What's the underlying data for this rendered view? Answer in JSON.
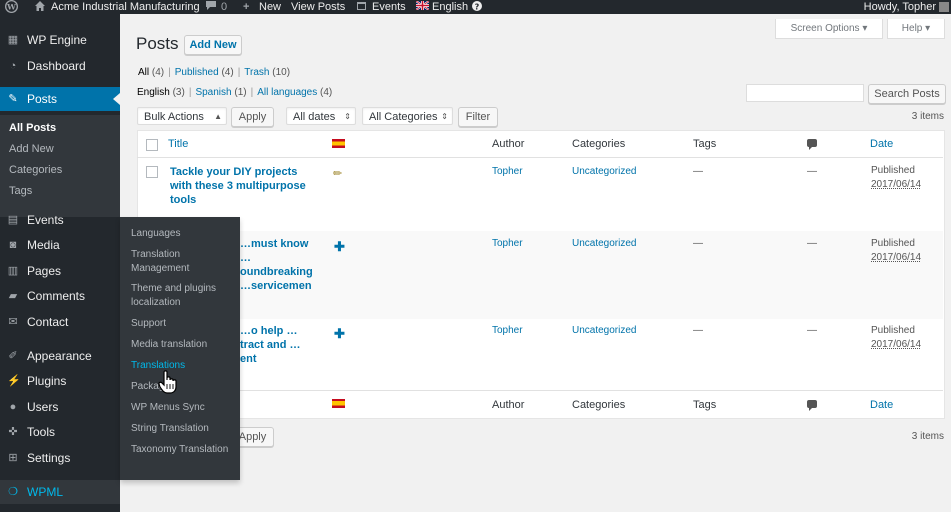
{
  "adminbar": {
    "site_name": "Acme Industrial Manufacturing",
    "comments_count": "0",
    "new_label": "New",
    "view_posts": "View Posts",
    "events": "Events",
    "language": "English",
    "howdy": "Howdy, Topher"
  },
  "sidebar": {
    "wp_engine": "WP Engine",
    "dashboard": "Dashboard",
    "posts": "Posts",
    "posts_submenu": [
      "All Posts",
      "Add New",
      "Categories",
      "Tags"
    ],
    "events": "Events",
    "media": "Media",
    "pages": "Pages",
    "comments": "Comments",
    "contact": "Contact",
    "appearance": "Appearance",
    "plugins": "Plugins",
    "users": "Users",
    "tools": "Tools",
    "settings": "Settings",
    "wpml": "WPML"
  },
  "wpml_flyout": [
    "Languages",
    "Translation Management",
    "Theme and plugins localization",
    "Support",
    "Media translation",
    "Translations",
    "Packages",
    "WP Menus Sync",
    "String Translation",
    "Taxonomy Translation"
  ],
  "screen_options": "Screen Options",
  "help": "Help",
  "page_title": "Posts",
  "add_new": "Add New",
  "status_filters": {
    "all": "All",
    "all_count": "(4)",
    "published": "Published",
    "published_count": "(4)",
    "trash": "Trash",
    "trash_count": "(10)"
  },
  "language_filters": {
    "english": "English",
    "english_count": "(3)",
    "spanish": "Spanish",
    "spanish_count": "(1)",
    "all_languages": "All languages",
    "all_languages_count": "(4)"
  },
  "search_button": "Search Posts",
  "search_value": "",
  "bulk_actions": "Bulk Actions",
  "apply": "Apply",
  "all_dates": "All dates",
  "all_categories": "All Categories",
  "filter": "Filter",
  "items_count": "3 items",
  "columns": {
    "title": "Title",
    "author": "Author",
    "categories": "Categories",
    "tags": "Tags",
    "date": "Date"
  },
  "rows": [
    {
      "title": "Tackle your DIY projects with these 3 multipurpose tools",
      "translation_status": "edit-pencil",
      "author": "Topher",
      "category": "Uncategorized",
      "tags": "—",
      "comments": "—",
      "status": "Published",
      "date": "2017/06/14"
    },
    {
      "title": "…must know …oundbreaking …servicemen",
      "translation_status": "add-plus",
      "author": "Topher",
      "category": "Uncategorized",
      "tags": "—",
      "comments": "—",
      "status": "Published",
      "date": "2017/06/14"
    },
    {
      "title": "…o help …tract and …ent",
      "translation_status": "add-plus",
      "author": "Topher",
      "category": "Uncategorized",
      "tags": "—",
      "comments": "—",
      "status": "Published",
      "date": "2017/06/14"
    }
  ],
  "colors": {
    "admin_bg": "#23282d",
    "accent": "#0073aa",
    "wpml": "#00b9eb"
  }
}
